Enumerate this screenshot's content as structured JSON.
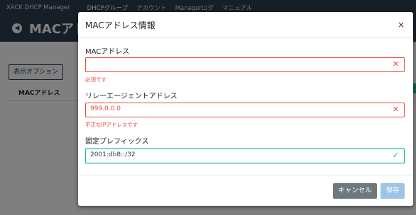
{
  "navbar": {
    "brand": "XACK DHCP Manager",
    "items": [
      "DHCPグループ",
      "アカウント",
      "Managerログ",
      "マニュアル"
    ]
  },
  "page": {
    "back_icon": "arrow-left-circle",
    "title": "MACアドレス情報",
    "options_button": "表示オプション",
    "column_header": "MACアドレス"
  },
  "modal": {
    "title": "MACアドレス情報",
    "close_label": "×",
    "fields": [
      {
        "label": "MACアドレス",
        "value": "",
        "state": "invalid",
        "help": "必須です"
      },
      {
        "label": "リレーエージェントアドレス",
        "value": "999.0.0.0",
        "state": "invalid",
        "help": "不正なIPアドレスです"
      },
      {
        "label": "固定プレフィックス",
        "value": "2001:db8::/32",
        "state": "valid",
        "help": ""
      }
    ],
    "cancel_label": "キャンセル",
    "save_label": "保存"
  },
  "colors": {
    "nav_background": "#2c3e50",
    "error": "#e74c3c",
    "success": "#18bc9c",
    "cancel_button": "#6c7a7d",
    "save_button_disabled": "#9ec4e6"
  }
}
